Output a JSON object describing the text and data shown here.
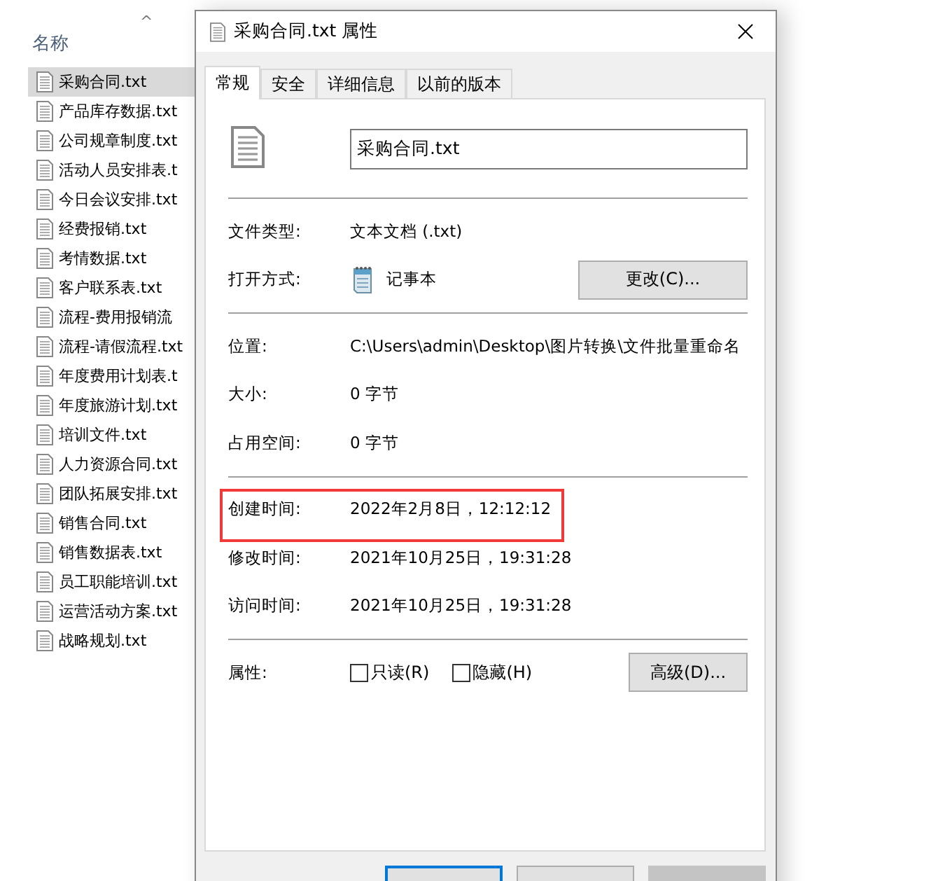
{
  "explorer": {
    "column_header": "名称",
    "sort_indicator": "^",
    "files": [
      {
        "name": "采购合同.txt",
        "selected": true
      },
      {
        "name": "产品库存数据.txt",
        "selected": false
      },
      {
        "name": "公司规章制度.txt",
        "selected": false
      },
      {
        "name": "活动人员安排表.t",
        "selected": false
      },
      {
        "name": "今日会议安排.txt",
        "selected": false
      },
      {
        "name": "经费报销.txt",
        "selected": false
      },
      {
        "name": "考情数据.txt",
        "selected": false
      },
      {
        "name": "客户联系表.txt",
        "selected": false
      },
      {
        "name": "流程-费用报销流",
        "selected": false
      },
      {
        "name": "流程-请假流程.txt",
        "selected": false
      },
      {
        "name": "年度费用计划表.t",
        "selected": false
      },
      {
        "name": "年度旅游计划.txt",
        "selected": false
      },
      {
        "name": "培训文件.txt",
        "selected": false
      },
      {
        "name": "人力资源合同.txt",
        "selected": false
      },
      {
        "name": "团队拓展安排.txt",
        "selected": false
      },
      {
        "name": "销售合同.txt",
        "selected": false
      },
      {
        "name": "销售数据表.txt",
        "selected": false
      },
      {
        "name": "员工职能培训.txt",
        "selected": false
      },
      {
        "name": "运营活动方案.txt",
        "selected": false
      },
      {
        "name": "战略规划.txt",
        "selected": false
      }
    ]
  },
  "dialog": {
    "title": "采购合同.txt 属性",
    "tabs": [
      {
        "label": "常规",
        "selected": true
      },
      {
        "label": "安全",
        "selected": false
      },
      {
        "label": "详细信息",
        "selected": false
      },
      {
        "label": "以前的版本",
        "selected": false
      }
    ],
    "file_name": "采购合同.txt",
    "sections": [
      [
        {
          "label": "文件类型:",
          "value": "文本文档 (.txt)",
          "highlighted": false
        },
        {
          "label": "打开方式:",
          "value": "记事本",
          "kind": "app",
          "button": "更改(C)...",
          "highlighted": false
        }
      ],
      [
        {
          "label": "位置:",
          "value": "C:\\Users\\admin\\Desktop\\图片转换\\文件批量重命名",
          "highlighted": false
        },
        {
          "label": "大小:",
          "value": "0 字节",
          "highlighted": false
        },
        {
          "label": "占用空间:",
          "value": "0 字节",
          "highlighted": false
        }
      ],
      [
        {
          "label": "创建时间:",
          "value": "2022年2月8日，12:12:12",
          "highlighted": true
        },
        {
          "label": "修改时间:",
          "value": "2021年10月25日，19:31:28",
          "highlighted": false
        },
        {
          "label": "访问时间:",
          "value": "2021年10月25日，19:31:28",
          "highlighted": false
        }
      ]
    ],
    "attributes": {
      "label": "属性:",
      "checkboxes": [
        {
          "label": "只读(R)",
          "checked": false
        },
        {
          "label": "隐藏(H)",
          "checked": false
        }
      ],
      "button": "高级(D)..."
    },
    "buttons": [
      {
        "kind": "default",
        "disabled": false
      },
      {
        "kind": "normal",
        "disabled": false
      },
      {
        "kind": "normal",
        "disabled": true
      }
    ]
  }
}
